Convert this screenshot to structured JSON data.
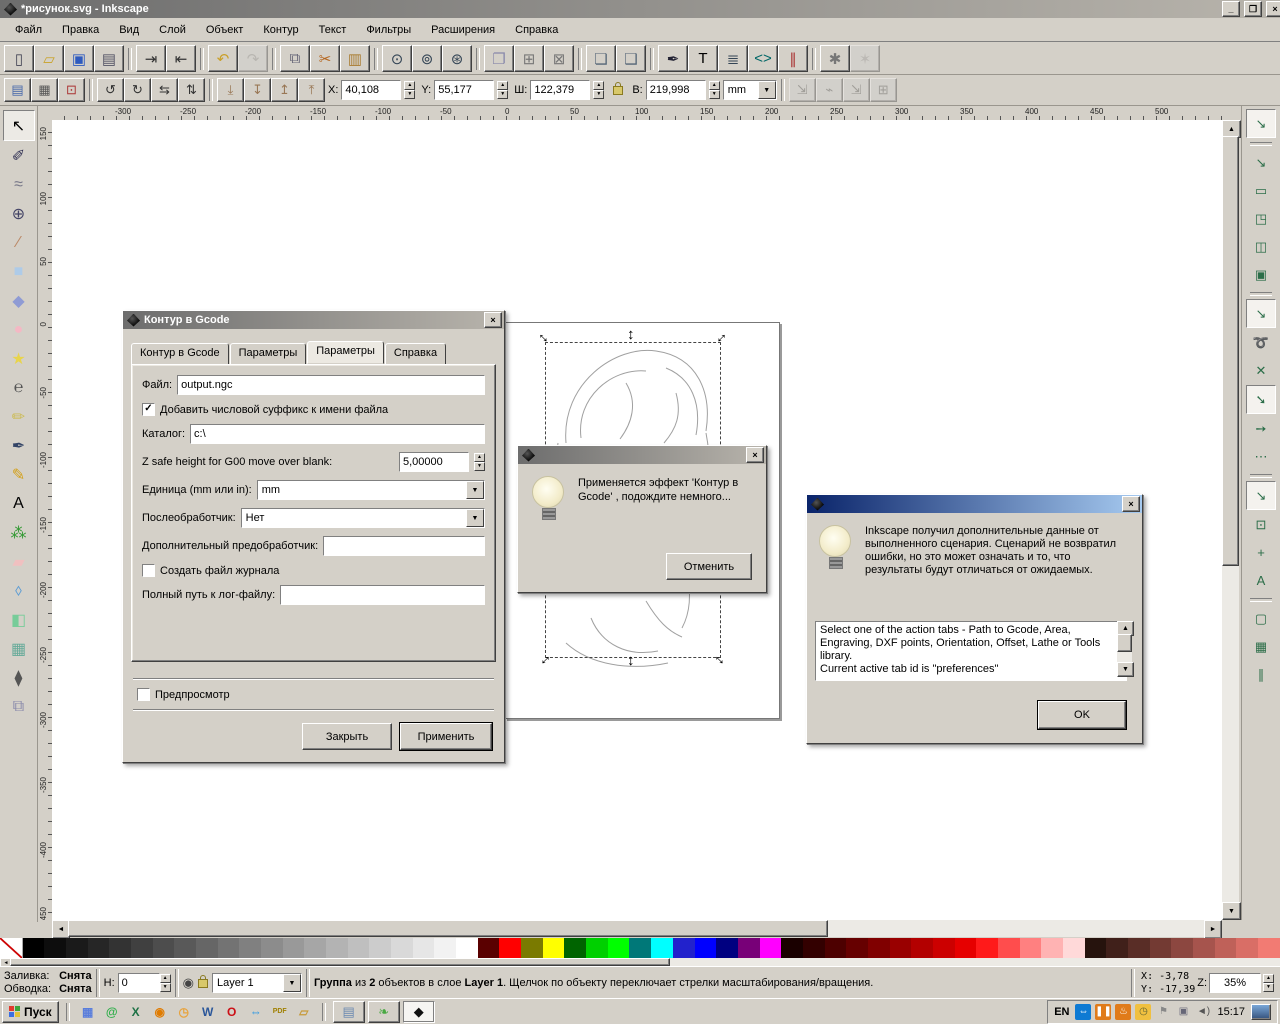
{
  "window": {
    "title": "*рисунок.svg - Inkscape"
  },
  "menu": {
    "items": [
      "Файл",
      "Правка",
      "Вид",
      "Слой",
      "Объект",
      "Контур",
      "Текст",
      "Фильтры",
      "Расширения",
      "Справка"
    ]
  },
  "toolbar_main": {
    "buttons": [
      {
        "name": "new-document",
        "glyph": "▯",
        "color": "#445"
      },
      {
        "name": "open-document",
        "glyph": "▱",
        "color": "#c9a227"
      },
      {
        "name": "save-document",
        "glyph": "▣",
        "color": "#2f5bbf"
      },
      {
        "name": "print",
        "glyph": "▤",
        "color": "#556"
      },
      {
        "sep": true
      },
      {
        "name": "import",
        "glyph": "⇥",
        "color": "#333"
      },
      {
        "name": "export",
        "glyph": "⇤",
        "color": "#333"
      },
      {
        "sep": true
      },
      {
        "name": "undo",
        "glyph": "↶",
        "color": "#caa02a"
      },
      {
        "name": "redo",
        "glyph": "↷",
        "color": "#7a9a6a",
        "disabled": true
      },
      {
        "sep": true
      },
      {
        "name": "copy",
        "glyph": "⧉",
        "color": "#667"
      },
      {
        "name": "cut",
        "glyph": "✂",
        "color": "#b5651d"
      },
      {
        "name": "paste",
        "glyph": "▥",
        "color": "#a97b2f"
      },
      {
        "sep": true
      },
      {
        "name": "zoom-selection",
        "glyph": "⊙",
        "color": "#345"
      },
      {
        "name": "zoom-drawing",
        "glyph": "⊚",
        "color": "#345"
      },
      {
        "name": "zoom-page",
        "glyph": "⊛",
        "color": "#345"
      },
      {
        "sep": true
      },
      {
        "name": "duplicate",
        "glyph": "❐",
        "color": "#88a"
      },
      {
        "name": "create-clone",
        "glyph": "⊞",
        "color": "#777"
      },
      {
        "name": "unlink-clone",
        "glyph": "⊠",
        "color": "#777"
      },
      {
        "sep": true
      },
      {
        "name": "group",
        "glyph": "❏",
        "color": "#567"
      },
      {
        "name": "ungroup",
        "glyph": "❑",
        "color": "#567"
      },
      {
        "sep": true
      },
      {
        "name": "fill-stroke-dialog",
        "glyph": "✒",
        "color": "#223"
      },
      {
        "name": "text-dialog",
        "glyph": "T",
        "color": "#000"
      },
      {
        "name": "layers-dialog",
        "glyph": "≣",
        "color": "#345"
      },
      {
        "name": "xml-editor",
        "glyph": "<>",
        "color": "#066"
      },
      {
        "name": "align-dialog",
        "glyph": "∥",
        "color": "#a33"
      },
      {
        "sep": true
      },
      {
        "name": "preferences",
        "glyph": "✱",
        "color": "#777"
      },
      {
        "name": "extension-tools",
        "glyph": "✶",
        "color": "#999",
        "disabled": true
      }
    ]
  },
  "toolbar_selection": {
    "pre_buttons": [
      {
        "name": "select-all",
        "glyph": "▤",
        "color": "#46a"
      },
      {
        "name": "select-all-layers",
        "glyph": "▦",
        "color": "#555"
      },
      {
        "name": "deselect",
        "glyph": "⊡",
        "color": "#a33"
      },
      {
        "sep": true
      },
      {
        "name": "rotate-ccw",
        "glyph": "↺",
        "color": "#333"
      },
      {
        "name": "rotate-cw",
        "glyph": "↻",
        "color": "#333"
      },
      {
        "name": "flip-horizontal",
        "glyph": "⇆",
        "color": "#333"
      },
      {
        "name": "flip-vertical",
        "glyph": "⇅",
        "color": "#333"
      },
      {
        "sep": true
      },
      {
        "name": "lower-to-bottom",
        "glyph": "⤓",
        "color": "#975"
      },
      {
        "name": "lower",
        "glyph": "↧",
        "color": "#975"
      },
      {
        "name": "raise",
        "glyph": "↥",
        "color": "#975"
      },
      {
        "name": "raise-to-top",
        "glyph": "⤒",
        "color": "#975"
      }
    ],
    "x_label": "X:",
    "x_value": "40,108",
    "y_label": "Y:",
    "y_value": "55,177",
    "w_label": "Ш:",
    "w_value": "122,379",
    "h_label": "В:",
    "h_value": "219,998",
    "unit_value": "mm",
    "post_buttons": [
      {
        "name": "transform-stroke",
        "glyph": "⇲",
        "color": "#555",
        "disabled": true
      },
      {
        "name": "transform-corners",
        "glyph": "⌁",
        "color": "#555",
        "disabled": true
      },
      {
        "name": "transform-gradient",
        "glyph": "⇲",
        "color": "#555",
        "disabled": true
      },
      {
        "name": "transform-pattern",
        "glyph": "⊞",
        "color": "#555",
        "disabled": true
      }
    ]
  },
  "rulers": {
    "h_labels": [
      "-300",
      "-250",
      "-200",
      "-150",
      "-100",
      "-50",
      "0",
      "50",
      "100",
      "150",
      "200",
      "250",
      "300",
      "350",
      "400",
      "450",
      "500"
    ],
    "v_labels": [
      "150",
      "100",
      "50",
      "0",
      "-50",
      "-100",
      "-150",
      "-200",
      "-250",
      "-300",
      "-350",
      "-400",
      "-450"
    ]
  },
  "tools": {
    "items": [
      {
        "name": "tool-selector",
        "glyph": "↖",
        "color": "#000",
        "active": true
      },
      {
        "name": "tool-node-editor",
        "glyph": "✐",
        "color": "#335"
      },
      {
        "name": "tool-tweak",
        "glyph": "≈",
        "color": "#778"
      },
      {
        "name": "tool-zoom",
        "glyph": "⊕",
        "color": "#446"
      },
      {
        "name": "tool-measure",
        "glyph": "∕",
        "color": "#b86"
      },
      {
        "name": "tool-rectangle",
        "glyph": "■",
        "color": "#aecbe8"
      },
      {
        "name": "tool-3dbox",
        "glyph": "◆",
        "color": "#8f9bd4"
      },
      {
        "name": "tool-ellipse",
        "glyph": "●",
        "color": "#f4b8c4"
      },
      {
        "name": "tool-star",
        "glyph": "★",
        "color": "#e8d44c"
      },
      {
        "name": "tool-spiral",
        "glyph": "℮",
        "color": "#555"
      },
      {
        "name": "tool-pencil",
        "glyph": "✏",
        "color": "#cb5"
      },
      {
        "name": "tool-pen",
        "glyph": "✒",
        "color": "#346"
      },
      {
        "name": "tool-calligraphy",
        "glyph": "✎",
        "color": "#d4a017"
      },
      {
        "name": "tool-text",
        "glyph": "A",
        "color": "#000"
      },
      {
        "name": "tool-spray",
        "glyph": "⁂",
        "color": "#393"
      },
      {
        "name": "tool-eraser",
        "glyph": "▰",
        "color": "#f0c0c0"
      },
      {
        "name": "tool-paint-bucket",
        "glyph": "⬨",
        "color": "#5a9bd4"
      },
      {
        "name": "tool-gradient",
        "glyph": "◧",
        "color": "#7c9"
      },
      {
        "name": "tool-mesh-gradient",
        "glyph": "▦",
        "color": "#6a9"
      },
      {
        "name": "tool-dropper",
        "glyph": "⧫",
        "color": "#555"
      },
      {
        "name": "tool-connector",
        "glyph": "⧉",
        "color": "#88a"
      }
    ]
  },
  "snapbar": {
    "items": [
      {
        "name": "snap-enable",
        "glyph": "↘",
        "pressed": true
      },
      {
        "sep": true
      },
      {
        "name": "snap-bbox",
        "glyph": "↘"
      },
      {
        "name": "snap-bbox-edges",
        "glyph": "▭"
      },
      {
        "name": "snap-bbox-corners",
        "glyph": "◳"
      },
      {
        "name": "snap-bbox-edge-midpoints",
        "glyph": "◫"
      },
      {
        "name": "snap-bbox-centers",
        "glyph": "▣"
      },
      {
        "sep": true
      },
      {
        "name": "snap-nodes",
        "glyph": "↘",
        "pressed": true
      },
      {
        "name": "snap-paths",
        "glyph": "➰"
      },
      {
        "name": "snap-path-intersections",
        "glyph": "✕"
      },
      {
        "name": "snap-cusp-nodes",
        "glyph": "➘",
        "pressed": true
      },
      {
        "name": "snap-smooth-nodes",
        "glyph": "➙"
      },
      {
        "name": "snap-line-midpoints",
        "glyph": "⋯"
      },
      {
        "sep": true
      },
      {
        "name": "snap-others",
        "glyph": "↘",
        "pressed": true
      },
      {
        "name": "snap-object-centers",
        "glyph": "⊡"
      },
      {
        "name": "snap-rotation-centers",
        "glyph": "+"
      },
      {
        "name": "snap-text-baselines",
        "glyph": "A"
      },
      {
        "sep": true
      },
      {
        "name": "snap-page-border",
        "glyph": "▢"
      },
      {
        "name": "snap-grids",
        "glyph": "▦"
      },
      {
        "name": "snap-guides",
        "glyph": "∥"
      }
    ]
  },
  "canvas": {
    "corner_glyph": "↔",
    "vertical_glyph": "↕",
    "horizontal_glyph": "↔"
  },
  "dialog_gcode": {
    "title": "Контур в Gcode",
    "tabs": [
      "Контур в Gcode",
      "Параметры",
      "Параметры",
      "Справка"
    ],
    "active_tab_index": 2,
    "file_label": "Файл:",
    "file_value": "output.ngc",
    "suffix_label": "Добавить числовой суффикс к имени файла",
    "dir_label": "Каталог:",
    "dir_value": "c:\\",
    "zsafe_label": "Z safe height for G00 move over blank:",
    "zsafe_value": "5,00000",
    "unit_label": "Единица (mm или in):",
    "unit_value": "mm",
    "post_label": "Послеобработчик:",
    "post_value": "Нет",
    "prepost_label": "Дополнительный предобработчик:",
    "prepost_value": "",
    "log_check_label": "Создать файл журнала",
    "logpath_label": "Полный путь к лог-файлу:",
    "logpath_value": "",
    "preview_label": "Предпросмотр",
    "close_label": "Закрыть",
    "apply_label": "Применить"
  },
  "dialog_progress": {
    "text": "Применяется эффект 'Контур в Gcode' , подождите немного...",
    "cancel_label": "Отменить"
  },
  "dialog_message": {
    "text": "Inkscape получил дополнительные данные от выполненного сценария. Сценарий не возвратил ошибки, но это может означать и то, что результаты будут отличаться от ожидаемых.",
    "details_line1": "Select one of the action tabs - Path to Gcode, Area, Engraving, DXF points, Orientation, Offset, Lathe or Tools library.",
    "details_line2": " Current active tab id is \"preferences\"",
    "ok_label": "OK"
  },
  "palette": {
    "colors": [
      "none",
      "#000000",
      "#0d0d0d",
      "#1a1a1a",
      "#262626",
      "#333333",
      "#404040",
      "#4d4d4d",
      "#595959",
      "#666666",
      "#737373",
      "#808080",
      "#8c8c8c",
      "#999999",
      "#a6a6a6",
      "#b3b3b3",
      "#bfbfbf",
      "#cccccc",
      "#d9d9d9",
      "#e6e6e6",
      "#f2f2f2",
      "#ffffff",
      "#5a0000",
      "#ff0000",
      "#7a7a00",
      "#ffff00",
      "#006400",
      "#00d000",
      "#00ff00",
      "#007878",
      "#00ffff",
      "#2222cc",
      "#0000ff",
      "#000080",
      "#780078",
      "#ff00ff",
      "#1a0000",
      "#330000",
      "#4d0000",
      "#660000",
      "#800000",
      "#990000",
      "#b30000",
      "#cc0000",
      "#e60000",
      "#ff1a1a",
      "#ff4d4d",
      "#ff8080",
      "#ffb3b3",
      "#ffd9d9",
      "#26130d",
      "#40201a",
      "#592d26",
      "#733a33",
      "#8c4740",
      "#a6544d",
      "#bf6159",
      "#d96e66",
      "#f27b73"
    ]
  },
  "statusbar": {
    "fill_label": "Заливка:",
    "fill_value": "Снята",
    "stroke_label": "Обводка:",
    "stroke_value": "Снята",
    "opacity_label": "Н:",
    "opacity_value": "0",
    "layer_value": "Layer 1",
    "message_segments": [
      {
        "t": "Группа",
        "b": true
      },
      {
        "t": " из "
      },
      {
        "t": "2",
        "b": true
      },
      {
        "t": " объектов в слое "
      },
      {
        "t": "Layer 1",
        "b": true
      },
      {
        "t": ". Щелчок по объекту переключает стрелки масштабирования/вращения."
      }
    ],
    "x_label": "X:",
    "x_value": "-3,78",
    "y_label": "Y:",
    "y_value": "-17,39",
    "z_label": "Z:",
    "zoom_value": "35%"
  },
  "taskbar": {
    "start_label": "Пуск",
    "lang": "EN",
    "time": "15:17",
    "quick_launch": [
      {
        "name": "calculator",
        "glyph": "▦",
        "color": "#5a7edc"
      },
      {
        "name": "messenger",
        "glyph": "@",
        "color": "#2fae4a"
      },
      {
        "name": "excel",
        "glyph": "X",
        "color": "#1e7145"
      },
      {
        "name": "antivirus",
        "glyph": "◉",
        "color": "#e07b00"
      },
      {
        "name": "organizer",
        "glyph": "◷",
        "color": "#e8a33d"
      },
      {
        "name": "word",
        "glyph": "W",
        "color": "#2b579a"
      },
      {
        "name": "opera",
        "glyph": "O",
        "color": "#cc0f16"
      },
      {
        "name": "teamviewer",
        "glyph": "⇔",
        "color": "#0e8ee9"
      },
      {
        "name": "pdf-app",
        "glyph": "PDF",
        "color": "#a08000"
      },
      {
        "name": "folder",
        "glyph": "▱",
        "color": "#c79b3b"
      }
    ],
    "windows": [
      {
        "name": "notepad-window",
        "glyph": "▤",
        "color": "#6a89b0"
      },
      {
        "name": "graphics-window",
        "glyph": "❧",
        "color": "#49a942"
      },
      {
        "name": "inkscape-window",
        "glyph": "◆",
        "color": "#111",
        "active": true
      }
    ],
    "tray": [
      {
        "name": "teamviewer-tray",
        "glyph": "⇔",
        "bg": "#0e7ad3",
        "fg": "#fff"
      },
      {
        "name": "pause-tray",
        "glyph": "❚❚",
        "bg": "#e07b1a",
        "fg": "#fff"
      },
      {
        "name": "update-tray",
        "glyph": "♨",
        "bg": "#e07b1a",
        "fg": "#fff"
      },
      {
        "name": "clock-tray",
        "glyph": "◷",
        "bg": "#f0c040",
        "fg": "#663"
      },
      {
        "name": "flag-tray",
        "glyph": "⚑",
        "bg": "transparent",
        "fg": "#888"
      },
      {
        "name": "network-tray",
        "glyph": "▣",
        "bg": "transparent",
        "fg": "#667"
      },
      {
        "name": "volume-tray",
        "glyph": "◄)",
        "bg": "transparent",
        "fg": "#555"
      }
    ]
  }
}
